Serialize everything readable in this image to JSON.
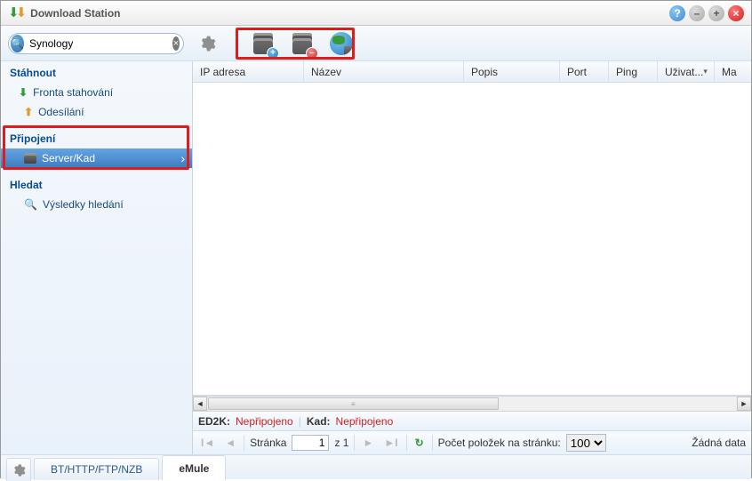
{
  "window": {
    "title": "Download Station"
  },
  "search": {
    "value": "Synology",
    "placeholder": ""
  },
  "toolbar": {
    "icons": {
      "add_server": "server-add",
      "remove_server": "server-remove",
      "globe_connect": "globe-connect"
    }
  },
  "sidebar": {
    "groups": [
      {
        "title": "Stáhnout",
        "items": [
          {
            "label": "Fronta stahování",
            "icon": "down"
          },
          {
            "label": "Odesílání",
            "icon": "up"
          }
        ]
      },
      {
        "title": "Připojení",
        "items": [
          {
            "label": "Server/Kad",
            "icon": "server",
            "active": true
          }
        ]
      },
      {
        "title": "Hledat",
        "items": [
          {
            "label": "Výsledky hledání",
            "icon": "search"
          }
        ]
      }
    ]
  },
  "columns": {
    "ip": "IP adresa",
    "name": "Název",
    "desc": "Popis",
    "port": "Port",
    "ping": "Ping",
    "user": "Uživat...",
    "ma": "Ma"
  },
  "status": {
    "ed2k_label": "ED2K:",
    "ed2k_value": "Nepřipojeno",
    "kad_label": "Kad:",
    "kad_value": "Nepřipojeno"
  },
  "pager": {
    "page_label": "Stránka",
    "page_value": "1",
    "of_text": "z 1",
    "per_page_label": "Počet položek na stránku:",
    "per_page_value": "100",
    "nodata": "Žádná data"
  },
  "tabs": {
    "bt": "BT/HTTP/FTP/NZB",
    "emule": "eMule"
  }
}
